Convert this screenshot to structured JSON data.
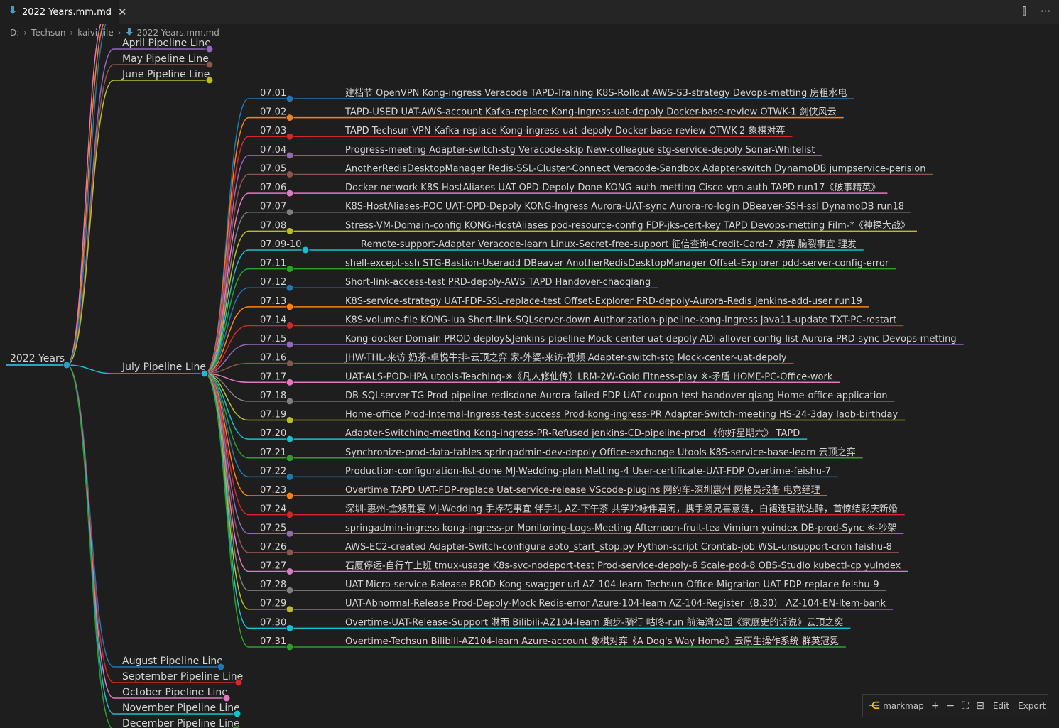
{
  "tab": {
    "title": "2022 Years.mm.md",
    "close": "✕",
    "icon": "markdown-down-arrow-icon"
  },
  "editor_actions": {
    "split": "⫿",
    "more": "···"
  },
  "breadcrumb": [
    "D:",
    "Techsun",
    "kaivi-file",
    "2022 Years.mm.md"
  ],
  "colors": {
    "background": "#1e1e1e",
    "root_line": "#2aa1c6",
    "palette": [
      "#1f77b4",
      "#ff7f0e",
      "#d62728",
      "#9467bd",
      "#8c564b",
      "#e377c2",
      "#7f7f7f",
      "#bcbd22",
      "#17becf",
      "#2ca02c"
    ]
  },
  "mindmap": {
    "root": "2022 Years",
    "months_top": [
      {
        "label": "April Pipeline Line",
        "color": "#9467bd"
      },
      {
        "label": "May Pipeline Line",
        "color": "#8c564b"
      },
      {
        "label": "June Pipeline Line",
        "color": "#bcbd22"
      }
    ],
    "july": {
      "label": "July Pipeline Line",
      "color": "#17becf"
    },
    "months_bottom": [
      {
        "label": "August Pipeline Line",
        "color": "#1f77b4"
      },
      {
        "label": "September Pipeline Line",
        "color": "#d62728"
      },
      {
        "label": "October Pipeline Line",
        "color": "#e377c2"
      },
      {
        "label": "November Pipeline Line",
        "color": "#17becf"
      },
      {
        "label": "December Pipeline Line",
        "color": "#2ca02c"
      }
    ],
    "july_days": [
      {
        "date": "07.01",
        "text": "建档节 OpenVPN Kong-ingress Veracode TAPD-Training K8S-Rollout AWS-S3-strategy Devops-metting 房租水电"
      },
      {
        "date": "07.02",
        "text": "TAPD-USED UAT-AWS-account Kafka-replace Kong-ingress-uat-depoly Docker-base-review OTWK-1 剑侠风云"
      },
      {
        "date": "07.03",
        "text": "TAPD Techsun-VPN Kafka-replace Kong-ingress-uat-depoly Docker-base-review OTWK-2 象棋对弈"
      },
      {
        "date": "07.04",
        "text": "Progress-meeting Adapter-switch-stg Veracode-skip New-colleague stg-service-depoly Sonar-Whitelist"
      },
      {
        "date": "07.05",
        "text": "AnotherRedisDesktopManager Redis-SSL-Cluster-Connect Veracode-Sandbox Adapter-switch DynamoDB jumpservice-perision"
      },
      {
        "date": "07.06",
        "text": "Docker-network K8S-HostAliases UAT-OPD-Depoly-Done KONG-auth-metting Cisco-vpn-auth TAPD run17《破事精英》"
      },
      {
        "date": "07.07",
        "text": "K8S-HostAliases-POC UAT-OPD-Depoly KONG-Ingress Aurora-UAT-sync Aurora-ro-login DBeaver-SSH-ssl DynamoDB run18"
      },
      {
        "date": "07.08",
        "text": "Stress-VM-Domain-config KONG-HostAliases pod-resource-config FDP-jks-cert-key TAPD Devops-metting Film-*《神探大战》"
      },
      {
        "date": "07.09-10",
        "text": "Remote-support-Adapter Veracode-learn Linux-Secret-free-support 征信查询-Credit-Card-7 对弈 脑裂事宜 理发"
      },
      {
        "date": "07.11",
        "text": "shell-except-ssh STG-Bastion-Useradd DBeaver AnotherRedisDesktopManager Offset-Explorer pdd-server-config-error"
      },
      {
        "date": "07.12",
        "text": "Short-link-access-test PRD-depoly-AWS TAPD Handover-chaoqiang"
      },
      {
        "date": "07.13",
        "text": "K8S-service-strategy UAT-FDP-SSL-replace-test Offset-Explorer PRD-depoly-Aurora-Redis Jenkins-add-user run19"
      },
      {
        "date": "07.14",
        "text": "K8S-volume-file KONG-lua Short-link-SQLserver-down Authorization-pipeline-kong-ingress java11-update TXT-PC-restart"
      },
      {
        "date": "07.15",
        "text": "Kong-docker-Domain PROD-deploy&Jenkins-pipeline Mock-center-uat-depoly ADi-allover-config-list Aurora-PRD-sync Devops-metting"
      },
      {
        "date": "07.16",
        "text": "JHW-THL-来访 奶茶-卓悦牛排-云顶之弈 家-外婆-来访-视频 Adapter-switch-stg Mock-center-uat-depoly"
      },
      {
        "date": "07.17",
        "text": "UAT-ALS-POD-HPA utools-Teaching-※《凡人修仙传》LRM-2W-Gold Fitness-play ※-矛盾 HOME-PC-Office-work"
      },
      {
        "date": "07.18",
        "text": "DB-SQLserver-TG Prod-pipeline-redisdone-Aurora-failed FDP-UAT-coupon-test handover-qiang Home-office-application"
      },
      {
        "date": "07.19",
        "text": "Home-office Prod-Internal-Ingress-test-success Prod-kong-ingress-PR Adapter-Switch-meeting HS-24-3day laob-birthday"
      },
      {
        "date": "07.20",
        "text": "Adapter-Switching-meeting Kong-ingress-PR-Refused jenkins-CD-pipeline-prod 《你好星期六》 TAPD"
      },
      {
        "date": "07.21",
        "text": "Synchronize-prod-data-tables springadmin-dev-depoly Office-exchange Utools K8S-service-base-learn 云顶之弈"
      },
      {
        "date": "07.22",
        "text": "Production-configuration-list-done MJ-Wedding-plan Metting-4 User-certificate-UAT-FDP Overtime-feishu-7"
      },
      {
        "date": "07.23",
        "text": "Overtime TAPD UAT-FDP-replace Uat-service-release VScode-plugins 网约车-深圳惠州 网格员报备 电竞经理"
      },
      {
        "date": "07.24",
        "text": "深圳-惠州-金矮胜宴 MJ-Wedding 手捧花事宜 伴手礼 AZ-下午茶 共学吟咏伴君闲，携手阙兄喜意涟，白裙连理犹沾醉，首惊结彩庆新婚"
      },
      {
        "date": "07.25",
        "text": "springadmin-ingress kong-ingress-pr Monitoring-Logs-Meeting Afternoon-fruit-tea Vimium yuindex DB-prod-Sync ※-吵架"
      },
      {
        "date": "07.26",
        "text": "AWS-EC2-created Adapter-Switch-configure aoto_start_stop.py Python-script Crontab-job WSL-unsupport-cron feishu-8"
      },
      {
        "date": "07.27",
        "text": "石厦停运-自行车上班 tmux-usage K8s-svc-nodeport-test Prod-service-depoly-6 Scale-pod-8 OBS-Studio kubectl-cp yuindex"
      },
      {
        "date": "07.28",
        "text": "UAT-Micro-service-Release PROD-Kong-swagger-url AZ-104-learn Techsun-Office-Migration UAT-FDP-replace feishu-9"
      },
      {
        "date": "07.29",
        "text": "UAT-Abnormal-Release Prod-Depoly-Mock Redis-error Azure-104-learn AZ-104-Register（8.30） AZ-104-EN-Item-bank"
      },
      {
        "date": "07.30",
        "text": "Overtime-UAT-Release-Support 淋雨 Bilibili-AZ104-learn 跑步-骑行 咕咚-run 前海湾公园《家庭史的诉说》云顶之奕"
      },
      {
        "date": "07.31",
        "text": "Overtime-Techsun Bilibili-AZ104-learn Azure-account 象棋对弈《A Dog's Way Home》云原生操作系统 群英冠冕"
      }
    ]
  },
  "toolbar": {
    "logo": "⋲",
    "brand": "markmap",
    "zoom_in": "+",
    "zoom_out": "−",
    "fit": "⛶",
    "toggle": "⊟",
    "edit": "Edit",
    "export": "Export"
  }
}
